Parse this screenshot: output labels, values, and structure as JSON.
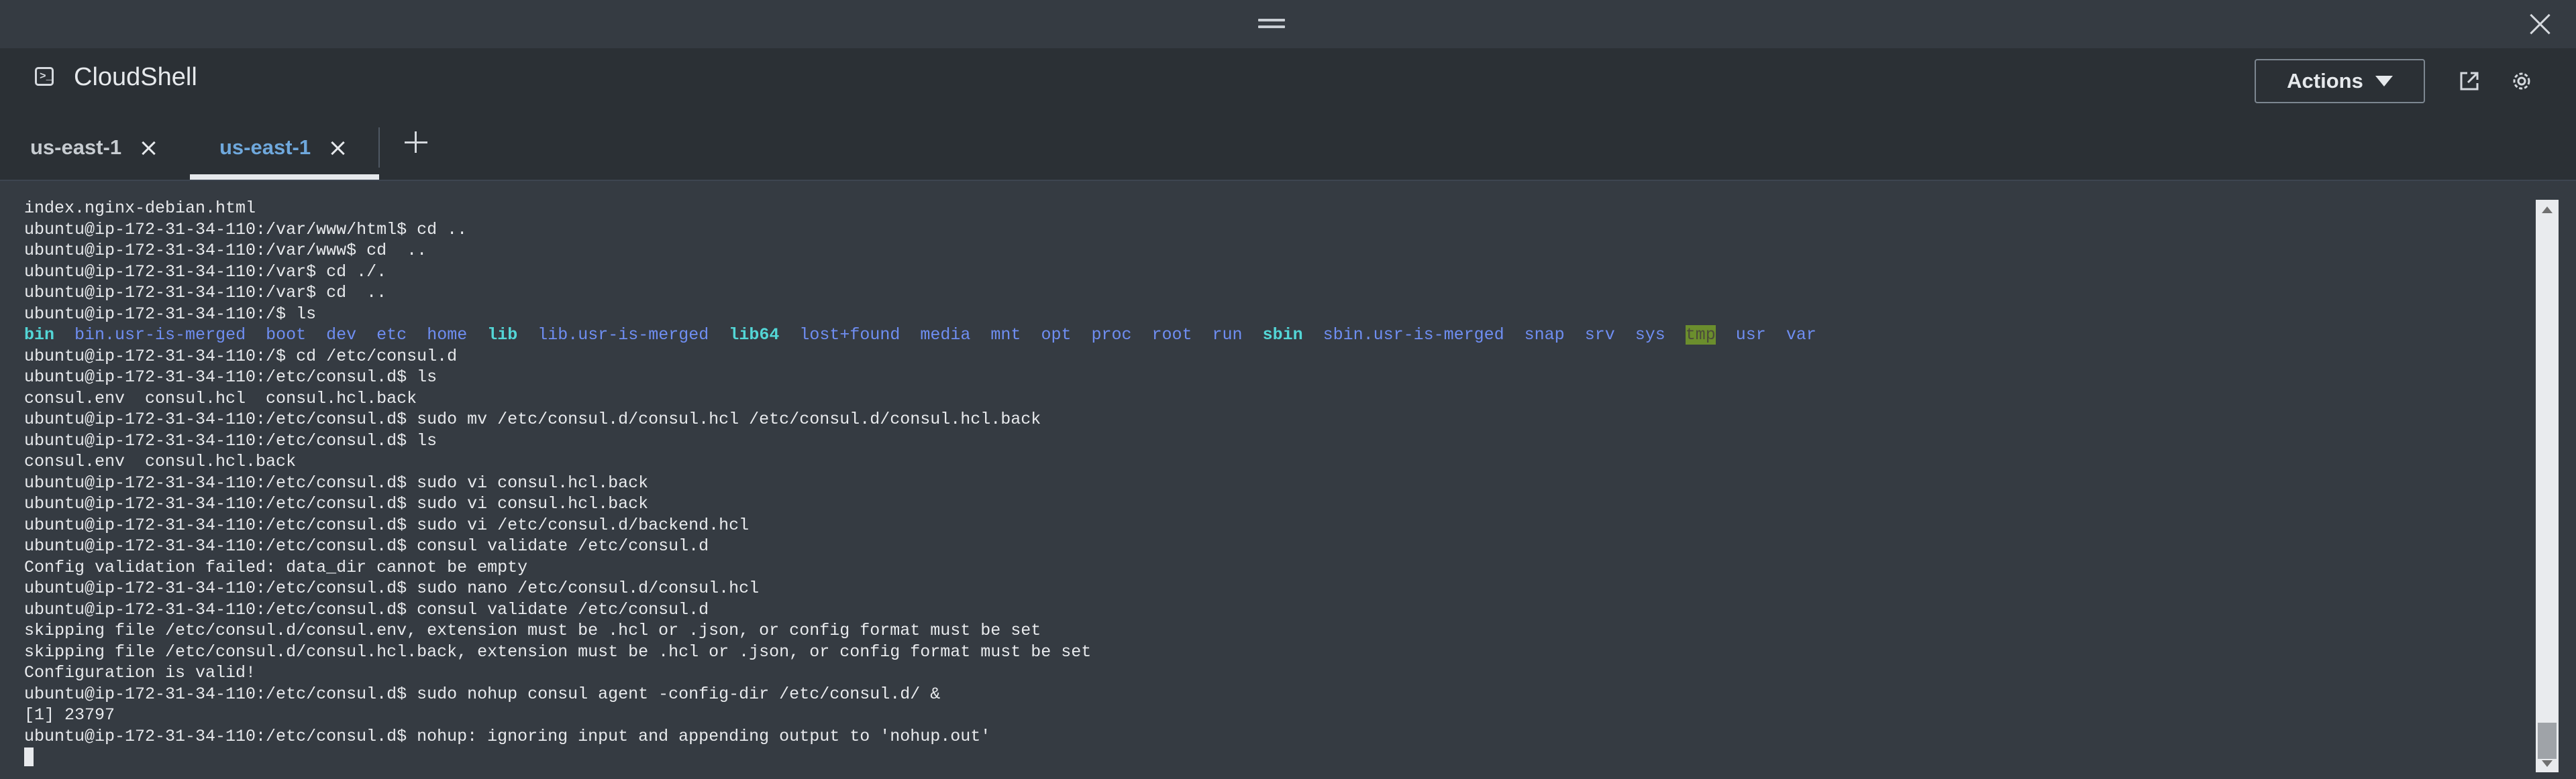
{
  "app": {
    "title": "CloudShell",
    "icon": "terminal-icon"
  },
  "header": {
    "actions_label": "Actions",
    "open_external_icon": "external-link-icon",
    "settings_icon": "gear-icon"
  },
  "tabs": [
    {
      "label": "us-east-1",
      "active": false
    },
    {
      "label": "us-east-1",
      "active": true
    }
  ],
  "colors": {
    "accent": "#6fa8dc",
    "background": "#353b42",
    "directory": "#6f8ef2",
    "symlink": "#53d6d6",
    "tmp_highlight": "#6b8e2d"
  },
  "terminal": {
    "lines": [
      "index.nginx-debian.html",
      "ubuntu@ip-172-31-34-110:/var/www/html$ cd ..",
      "ubuntu@ip-172-31-34-110:/var/www$ cd  ..",
      "ubuntu@ip-172-31-34-110:/var$ cd ./.",
      "ubuntu@ip-172-31-34-110:/var$ cd  ..",
      "ubuntu@ip-172-31-34-110:/$ ls",
      "",
      "ubuntu@ip-172-31-34-110:/$ cd /etc/consul.d",
      "ubuntu@ip-172-31-34-110:/etc/consul.d$ ls",
      "consul.env  consul.hcl  consul.hcl.back",
      "ubuntu@ip-172-31-34-110:/etc/consul.d$ sudo mv /etc/consul.d/consul.hcl /etc/consul.d/consul.hcl.back",
      "ubuntu@ip-172-31-34-110:/etc/consul.d$ ls",
      "consul.env  consul.hcl.back",
      "ubuntu@ip-172-31-34-110:/etc/consul.d$ sudo vi consul.hcl.back",
      "ubuntu@ip-172-31-34-110:/etc/consul.d$ sudo vi consul.hcl.back",
      "ubuntu@ip-172-31-34-110:/etc/consul.d$ sudo vi /etc/consul.d/backend.hcl",
      "ubuntu@ip-172-31-34-110:/etc/consul.d$ consul validate /etc/consul.d",
      "Config validation failed: data_dir cannot be empty",
      "ubuntu@ip-172-31-34-110:/etc/consul.d$ sudo nano /etc/consul.d/consul.hcl",
      "ubuntu@ip-172-31-34-110:/etc/consul.d$ consul validate /etc/consul.d",
      "skipping file /etc/consul.d/consul.env, extension must be .hcl or .json, or config format must be set",
      "skipping file /etc/consul.d/consul.hcl.back, extension must be .hcl or .json, or config format must be set",
      "Configuration is valid!",
      "ubuntu@ip-172-31-34-110:/etc/consul.d$ sudo nohup consul agent -config-dir /etc/consul.d/ &",
      "[1] 23797",
      "ubuntu@ip-172-31-34-110:/etc/consul.d$ nohup: ignoring input and appending output to 'nohup.out'"
    ],
    "ls_line_index": 6,
    "ls_entries": [
      {
        "name": "bin",
        "type": "link"
      },
      {
        "name": "bin.usr-is-merged",
        "type": "dir"
      },
      {
        "name": "boot",
        "type": "dir"
      },
      {
        "name": "dev",
        "type": "dir"
      },
      {
        "name": "etc",
        "type": "dir"
      },
      {
        "name": "home",
        "type": "dir"
      },
      {
        "name": "lib",
        "type": "link"
      },
      {
        "name": "lib.usr-is-merged",
        "type": "dir"
      },
      {
        "name": "lib64",
        "type": "link"
      },
      {
        "name": "lost+found",
        "type": "dir"
      },
      {
        "name": "media",
        "type": "dir"
      },
      {
        "name": "mnt",
        "type": "dir"
      },
      {
        "name": "opt",
        "type": "dir"
      },
      {
        "name": "proc",
        "type": "dir"
      },
      {
        "name": "root",
        "type": "dir"
      },
      {
        "name": "run",
        "type": "dir"
      },
      {
        "name": "sbin",
        "type": "link"
      },
      {
        "name": "sbin.usr-is-merged",
        "type": "dir"
      },
      {
        "name": "snap",
        "type": "dir"
      },
      {
        "name": "srv",
        "type": "dir"
      },
      {
        "name": "sys",
        "type": "dir"
      },
      {
        "name": "tmp",
        "type": "tmp"
      },
      {
        "name": "usr",
        "type": "dir"
      },
      {
        "name": "var",
        "type": "dir"
      }
    ]
  }
}
